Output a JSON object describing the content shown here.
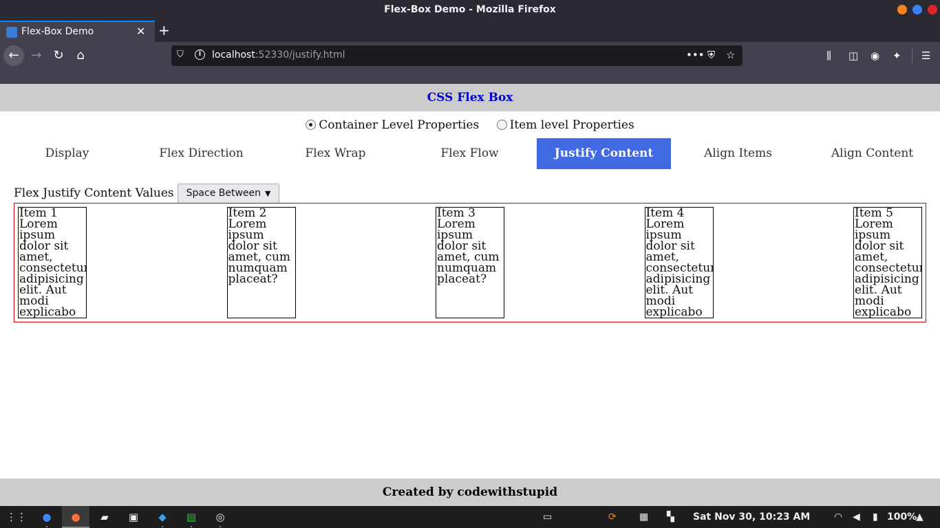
{
  "window": {
    "title": "Flex-Box Demo - Mozilla Firefox",
    "controls": {
      "minimize_color": "#f6851b",
      "maximize_color": "#3b82f6",
      "close_color": "#e0242b"
    }
  },
  "browser": {
    "tab_title": "Flex-Box Demo",
    "new_tab": "+",
    "url_host": "localhost",
    "url_rest": ":52330/justify.html",
    "page_actions": "•••"
  },
  "page": {
    "header_title": "CSS Flex Box",
    "radio_options": [
      {
        "label": "Container Level Properties",
        "checked": true
      },
      {
        "label": "Item level Properties",
        "checked": false
      }
    ],
    "tabs": [
      {
        "label": "Display",
        "active": false
      },
      {
        "label": "Flex Direction",
        "active": false
      },
      {
        "label": "Flex Wrap",
        "active": false
      },
      {
        "label": "Flex Flow",
        "active": false
      },
      {
        "label": "Justify Content",
        "active": true
      },
      {
        "label": "Align Items",
        "active": false
      },
      {
        "label": "Align Content",
        "active": false
      }
    ],
    "control_label": "Flex Justify Content Values",
    "select_value": "Space Between",
    "items": [
      "Item 1 Lorem ipsum dolor sit amet, consectetur adipisicing elit. Aut modi explicabo facilis?",
      "Item 2 Lorem ipsum dolor sit amet, cum numquam placeat?",
      "Item 3 Lorem ipsum dolor sit amet, cum numquam placeat?",
      "Item 4 Lorem ipsum dolor sit amet, consectetur adipisicing elit. Aut modi explicabo facilis?",
      "Item 5 Lorem ipsum dolor sit amet, consectetur adipisicing elit. Aut modi explicabo facilis?"
    ],
    "footer_text": "Created by codewithstupid"
  },
  "taskbar": {
    "clock": "Sat Nov 30, 10:23 AM",
    "battery": "100%"
  },
  "colors": {
    "active_tab": "#4169e1",
    "header_title": "#0000cc",
    "container_border": "#cc0000"
  }
}
